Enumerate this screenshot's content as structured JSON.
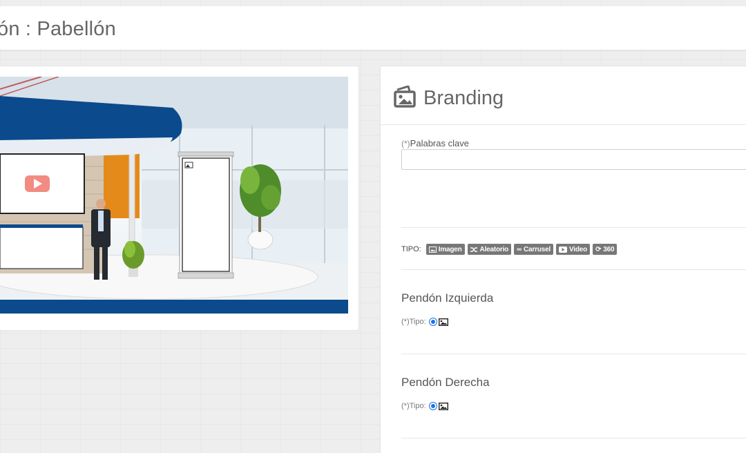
{
  "header": {
    "title": "ón : Pabellón"
  },
  "branding": {
    "title": "Branding",
    "keywords_required": "(*)",
    "keywords_label": "Palabras clave",
    "keywords_value": "",
    "tipo_label": "TIPO:",
    "types": [
      {
        "label": "Imagen",
        "icon": "image-icon"
      },
      {
        "label": "Aleatorio",
        "icon": "shuffle-icon"
      },
      {
        "label": "Carrusel",
        "icon": "infinity-icon"
      },
      {
        "label": "Video",
        "icon": "youtube-icon"
      },
      {
        "label": "360",
        "icon": "refresh-icon"
      }
    ],
    "sections": [
      {
        "title": "Pendón Izquierda",
        "tipo_label": "(*)Tipo:",
        "selected": "Imagen"
      },
      {
        "title": "Pendón Derecha",
        "tipo_label": "(*)Tipo:",
        "selected": "Imagen"
      }
    ]
  },
  "colors": {
    "badge": "#777777",
    "radio": "#1a73e8",
    "booth_blue": "#0b4a8c",
    "accent_orange": "#e48a1a"
  }
}
